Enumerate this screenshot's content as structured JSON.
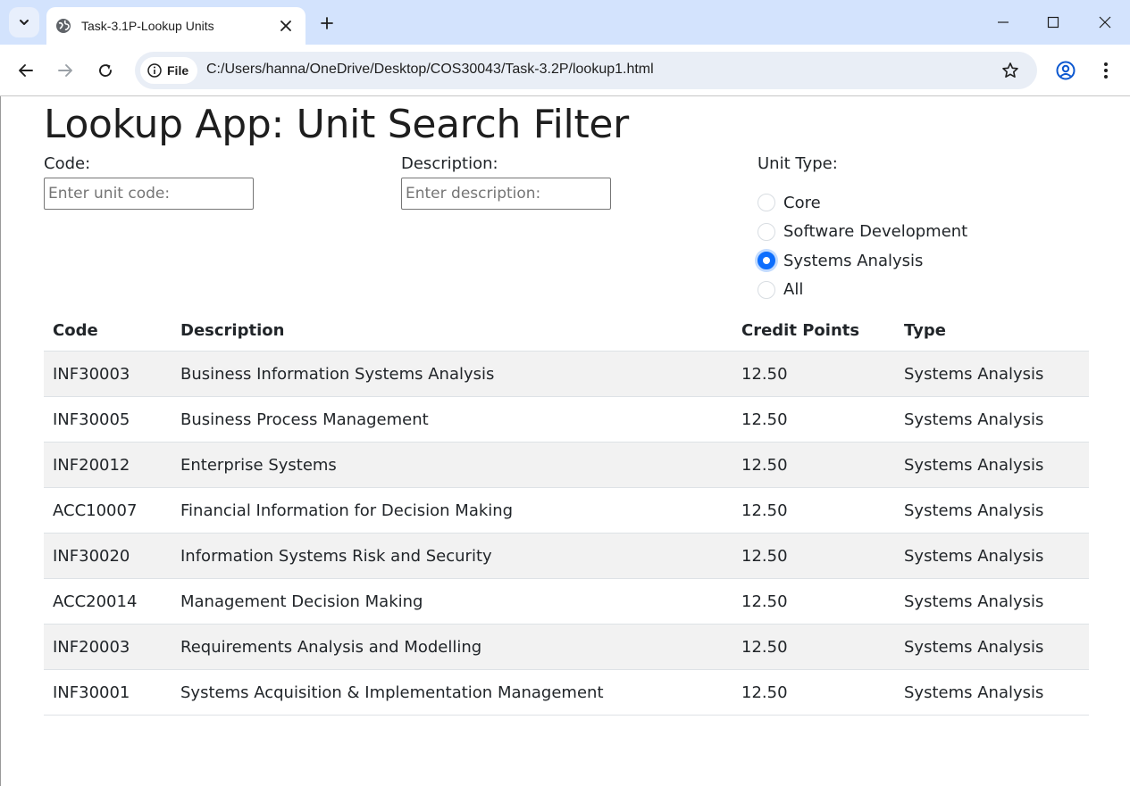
{
  "browser": {
    "tab_title": "Task-3.1P-Lookup Units",
    "site_chip_label": "File",
    "url": "C:/Users/hanna/OneDrive/Desktop/COS30043/Task-3.2P/lookup1.html"
  },
  "page": {
    "title": "Lookup App: Unit Search Filter",
    "code_label": "Code:",
    "code_placeholder": "Enter unit code:",
    "code_value": "",
    "description_label": "Description:",
    "description_placeholder": "Enter description:",
    "description_value": "",
    "unit_type_label": "Unit Type:",
    "unit_types": [
      {
        "label": "Core",
        "checked": false
      },
      {
        "label": "Software Development",
        "checked": false
      },
      {
        "label": "Systems Analysis",
        "checked": true
      },
      {
        "label": "All",
        "checked": false
      }
    ]
  },
  "table": {
    "headers": [
      "Code",
      "Description",
      "Credit Points",
      "Type"
    ],
    "rows": [
      [
        "INF30003",
        "Business Information Systems Analysis",
        "12.50",
        "Systems Analysis"
      ],
      [
        "INF30005",
        "Business Process Management",
        "12.50",
        "Systems Analysis"
      ],
      [
        "INF20012",
        "Enterprise Systems",
        "12.50",
        "Systems Analysis"
      ],
      [
        "ACC10007",
        "Financial Information for Decision Making",
        "12.50",
        "Systems Analysis"
      ],
      [
        "INF30020",
        "Information Systems Risk and Security",
        "12.50",
        "Systems Analysis"
      ],
      [
        "ACC20014",
        "Management Decision Making",
        "12.50",
        "Systems Analysis"
      ],
      [
        "INF20003",
        "Requirements Analysis and Modelling",
        "12.50",
        "Systems Analysis"
      ],
      [
        "INF30001",
        "Systems Acquisition & Implementation Management",
        "12.50",
        "Systems Analysis"
      ]
    ]
  },
  "colors": {
    "titlebar": "#d3e3fd",
    "omnibox": "#e9eef6",
    "accent": "#0d6efd",
    "striped_row": "#f2f2f2"
  }
}
